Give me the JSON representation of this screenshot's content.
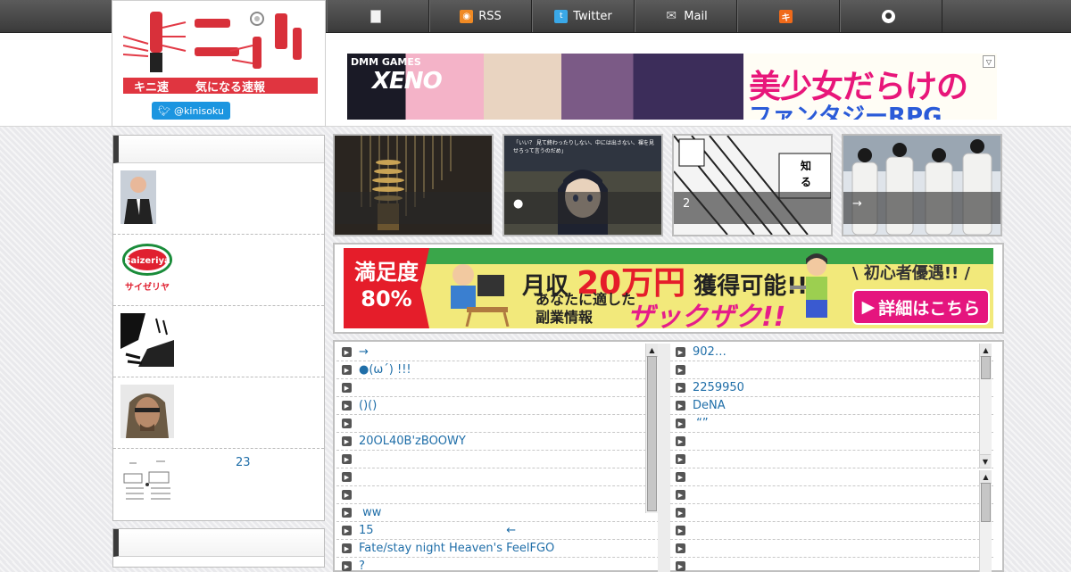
{
  "nav": {
    "items": [
      {
        "label": "",
        "icon": "document-icon"
      },
      {
        "label": "RSS",
        "icon": "rss-icon"
      },
      {
        "label": "Twitter",
        "icon": "twitter-icon"
      },
      {
        "label": "Mail",
        "icon": "mail-icon"
      },
      {
        "label": "",
        "icon": "ki-icon"
      },
      {
        "label": "",
        "icon": "face-icon"
      }
    ]
  },
  "logo": {
    "left_text": "キニ速",
    "right_text": "気になる速報",
    "twitter_handle": "@kinisoku"
  },
  "top_banner": {
    "brand": "DMM GAMES",
    "game": "XENO",
    "headline": "美少女だらけの",
    "subline": "ファンタジーRPG"
  },
  "sidebar": {
    "items": [
      {
        "text": ""
      },
      {
        "text": ""
      },
      {
        "text": ""
      },
      {
        "text": ""
      },
      {
        "text": "23"
      }
    ],
    "saizeriya_text": "Saizeriya",
    "saizeriya_kana": "サイゼリヤ"
  },
  "featured": [
    {
      "caption": ""
    },
    {
      "caption": "●",
      "quote": "「いい？ 見て終わったりしない、中には出さない、裸を見せろって言うのだめ」"
    },
    {
      "caption": "2"
    },
    {
      "caption": "→"
    }
  ],
  "ad": {
    "badge_line1": "満足度",
    "badge_line2": "80%",
    "monthly": "月収",
    "amount": "20万円",
    "amount_suffix": "獲得可能!!",
    "line_a": "あなたに適した",
    "line_b": "副業情報",
    "zakuzaku": "ザックザク!!",
    "beginners": "\\ 初心者優遇!! /",
    "cta": "詳細はこちら"
  },
  "list_left": [
    "→",
    "●(ω´) !!!",
    "",
    "()()",
    "",
    "20OL40B'zBOOWY",
    "",
    "",
    "",
    " ww",
    "15                                    ←",
    "Fate/stay night Heaven's FeelFGO",
    "?"
  ],
  "list_right": [
    "902…",
    "",
    "2259950",
    "DeNA",
    " “”",
    "",
    "",
    "",
    "",
    "",
    "",
    "",
    ""
  ],
  "colors": {
    "link": "#1f6ea8",
    "logo_red": "#e03540",
    "twitter": "#1b95e0",
    "nav_bg": "#444444"
  }
}
